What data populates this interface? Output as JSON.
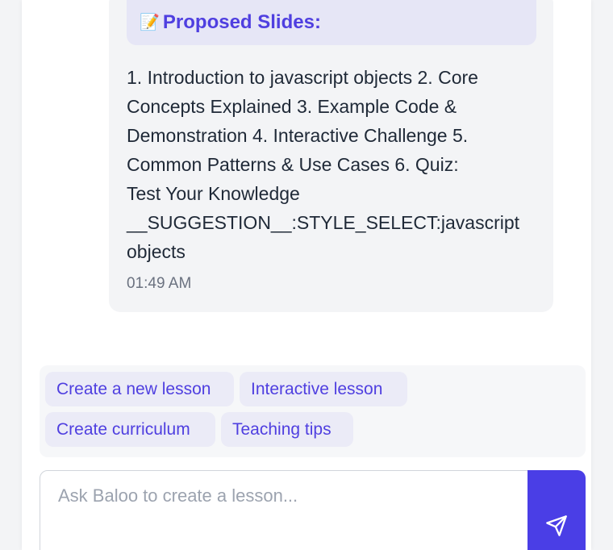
{
  "message": {
    "slides_header": {
      "icon": "memo-icon",
      "title": "Proposed Slides:"
    },
    "text": "1. Introduction to javascript objects 2. Core\nConcepts Explained 3. Example Code &\nDemonstration 4. Interactive Challenge 5.\nCommon Patterns & Use Cases 6. Quiz:\nTest Your Knowledge\n__SUGGESTION__:STYLE_SELECT:javascript\nobjects",
    "timestamp": "01:49 AM"
  },
  "suggestions": [
    {
      "label": "Create a new lesson"
    },
    {
      "label": "Interactive lesson"
    },
    {
      "label": "Create curriculum"
    },
    {
      "label": "Teaching tips"
    }
  ],
  "composer": {
    "placeholder": "Ask Baloo to create a lesson...",
    "value": "",
    "send_icon": "send-icon"
  },
  "colors": {
    "accent": "#4f3fe0",
    "send_button": "#4a3ee6",
    "chip_bg": "#ebebf7",
    "header_bg": "#e6e6f6",
    "bubble_bg": "#f3f4f6"
  }
}
